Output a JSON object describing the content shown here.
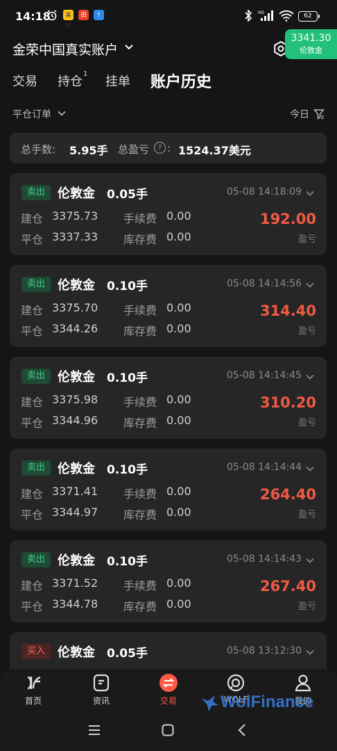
{
  "status_bar": {
    "time": "14:18",
    "battery": "62",
    "net": "HD"
  },
  "header": {
    "account_title": "金荣中国真实账户",
    "price_badge": {
      "price": "3341.30",
      "name": "伦敦金"
    }
  },
  "tabs": [
    {
      "label": "交易"
    },
    {
      "label": "持仓",
      "badge": "1"
    },
    {
      "label": "挂单"
    },
    {
      "label": "账户历史",
      "active": true
    }
  ],
  "filter": {
    "label": "平仓订单",
    "period": "今日"
  },
  "summary": {
    "total_lots_label": "总手数:",
    "total_lots": "5.95手",
    "total_pnl_label": "总盈亏",
    "total_pnl_colon": ":",
    "total_pnl": "1524.37美元",
    "help_symbol": "?"
  },
  "labels": {
    "open": "建仓",
    "close": "平仓",
    "fee": "手续费",
    "swap": "库存费",
    "pnl": "盈亏"
  },
  "orders": [
    {
      "side": "卖出",
      "symbol": "伦敦金",
      "lots": "0.05手",
      "time": "05-08 14:18:09",
      "open": "3375.73",
      "close": "3337.33",
      "fee": "0.00",
      "swap": "0.00",
      "pnl": "192.00"
    },
    {
      "side": "卖出",
      "symbol": "伦敦金",
      "lots": "0.10手",
      "time": "05-08 14:14:56",
      "open": "3375.70",
      "close": "3344.26",
      "fee": "0.00",
      "swap": "0.00",
      "pnl": "314.40"
    },
    {
      "side": "卖出",
      "symbol": "伦敦金",
      "lots": "0.10手",
      "time": "05-08 14:14:45",
      "open": "3375.98",
      "close": "3344.96",
      "fee": "0.00",
      "swap": "0.00",
      "pnl": "310.20"
    },
    {
      "side": "卖出",
      "symbol": "伦敦金",
      "lots": "0.10手",
      "time": "05-08 14:14:44",
      "open": "3371.41",
      "close": "3344.97",
      "fee": "0.00",
      "swap": "0.00",
      "pnl": "264.40"
    },
    {
      "side": "卖出",
      "symbol": "伦敦金",
      "lots": "0.10手",
      "time": "05-08 14:14:43",
      "open": "3371.52",
      "close": "3344.78",
      "fee": "0.00",
      "swap": "0.00",
      "pnl": "267.40"
    },
    {
      "side": "买入",
      "symbol": "伦敦金",
      "lots": "0.05手",
      "time": "05-08 13:12:30"
    }
  ],
  "bottom_nav": [
    {
      "label": "首页",
      "icon": "home-icon"
    },
    {
      "label": "资讯",
      "icon": "news-icon"
    },
    {
      "label": "交易",
      "icon": "trade-icon",
      "active": true
    },
    {
      "label": "WOLF",
      "icon": "wolf-icon"
    },
    {
      "label": "我的",
      "icon": "profile-icon"
    }
  ],
  "watermark": "WolFinance",
  "colors": {
    "profit": "#f05a44",
    "sell": "#3fd08c",
    "buy": "#ff6a59",
    "badge_green": "#22c07a"
  }
}
